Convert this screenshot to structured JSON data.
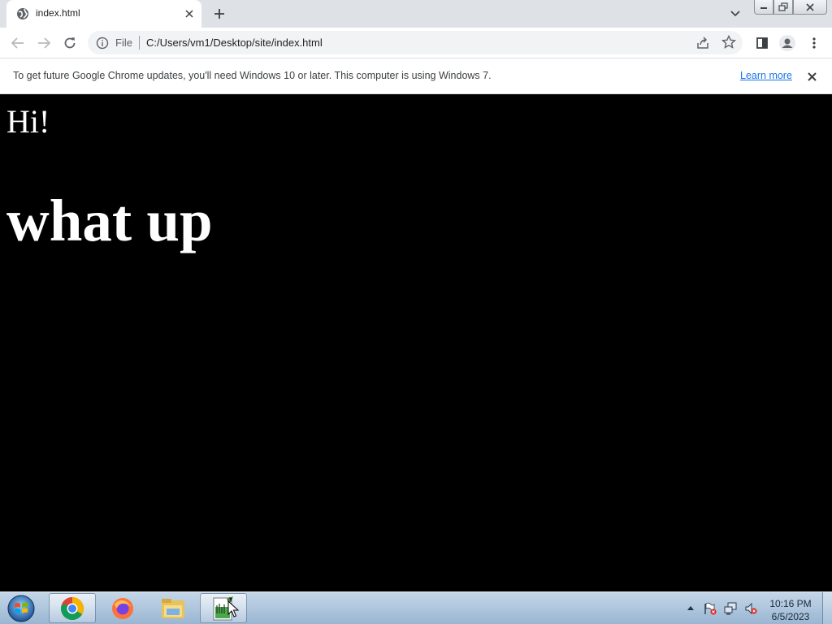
{
  "tab": {
    "title": "index.html"
  },
  "omnibox": {
    "scheme": "File",
    "url": "C:/Users/vm1/Desktop/site/index.html"
  },
  "infobar": {
    "message": "To get future Google Chrome updates, you'll need Windows 10 or later. This computer is using Windows 7.",
    "link": "Learn more"
  },
  "page": {
    "heading_small": "Hi!",
    "heading_big": "what up"
  },
  "taskbar": {
    "apps": [
      "chrome-icon",
      "firefox-icon",
      "file-explorer-icon",
      "paint-icon"
    ],
    "clock_time": "10:16 PM",
    "clock_date": "6/5/2023"
  }
}
